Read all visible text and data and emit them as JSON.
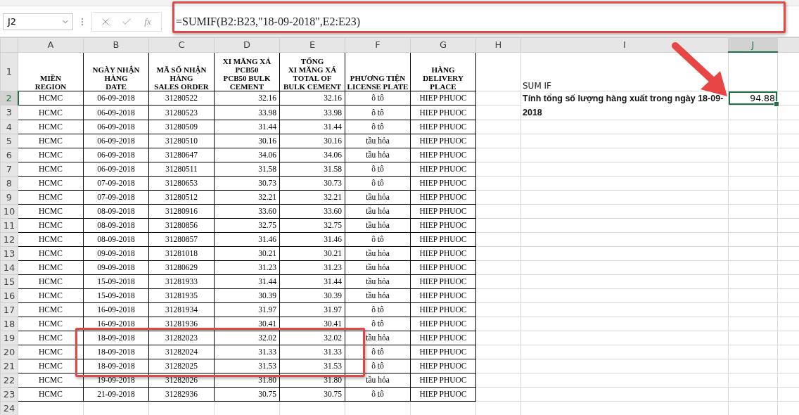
{
  "formula_bar": {
    "name_box": "J2",
    "function_label": "fx",
    "formula": "=SUMIF(B2:B23,\"18-09-2018\",E2:E23)"
  },
  "columns": [
    {
      "label": "A",
      "selected": false
    },
    {
      "label": "B",
      "selected": false
    },
    {
      "label": "C",
      "selected": false
    },
    {
      "label": "D",
      "selected": false
    },
    {
      "label": "E",
      "selected": false
    },
    {
      "label": "F",
      "selected": false
    },
    {
      "label": "G",
      "selected": false
    },
    {
      "label": "H",
      "selected": false
    },
    {
      "label": "I",
      "selected": false
    },
    {
      "label": "J",
      "selected": true
    }
  ],
  "header_row": {
    "number": "1",
    "selected": false,
    "cells": [
      "MIỀN\nREGION",
      "NGÀY NHẬN\nHÀNG\nDATE",
      "MÃ SỐ NHẬN\nHÀNG\nSALES ORDER",
      "XI MĂNG XÁ\nPCB50\nPCB50 BULK\nCEMENT",
      "TỔNG\nXI MĂNG XÁ\nTOTAL OF\nBULK CEMENT",
      "PHƯƠNG TIỆN\nLICENSE PLATE",
      "HÀNG\nDELIVERY\nPLACE"
    ]
  },
  "summary": {
    "label": "SUM IF",
    "description": "Tính tổng số lượng hàng xuất trong ngày 18-09-2018",
    "result": "94.88",
    "result_selected": true
  },
  "rows": [
    {
      "number": "2",
      "selected": true,
      "cells": [
        "HCMC",
        "06-09-2018",
        "31280522",
        "32.16",
        "32.16",
        "ô tô",
        "HIEP PHUOC"
      ]
    },
    {
      "number": "3",
      "selected": false,
      "cells": [
        "HCMC",
        "06-09-2018",
        "31280523",
        "33.98",
        "33.98",
        "ô tô",
        "HIEP PHUOC"
      ]
    },
    {
      "number": "4",
      "selected": false,
      "cells": [
        "HCMC",
        "06-09-2018",
        "31280509",
        "31.44",
        "31.44",
        "ô tô",
        "HIEP PHUOC"
      ]
    },
    {
      "number": "5",
      "selected": false,
      "cells": [
        "HCMC",
        "06-09-2018",
        "31280510",
        "30.16",
        "30.16",
        "tầu hỏa",
        "HIEP PHUOC"
      ]
    },
    {
      "number": "6",
      "selected": false,
      "cells": [
        "HCMC",
        "06-09-2018",
        "31280647",
        "34.06",
        "34.06",
        "tầu hỏa",
        "HIEP PHUOC"
      ]
    },
    {
      "number": "7",
      "selected": false,
      "cells": [
        "HCMC",
        "06-09-2018",
        "31280511",
        "31.58",
        "31.58",
        "ô tô",
        "HIEP PHUOC"
      ]
    },
    {
      "number": "8",
      "selected": false,
      "cells": [
        "HCMC",
        "07-09-2018",
        "31280653",
        "30.73",
        "30.73",
        "ô tô",
        "HIEP PHUOC"
      ]
    },
    {
      "number": "9",
      "selected": false,
      "cells": [
        "HCMC",
        "07-09-2018",
        "31280512",
        "32.21",
        "32.21",
        "tầu hỏa",
        "HIEP PHUOC"
      ]
    },
    {
      "number": "10",
      "selected": false,
      "cells": [
        "HCMC",
        "08-09-2018",
        "31280916",
        "33.60",
        "33.60",
        "tầu hỏa",
        "HIEP PHUOC"
      ]
    },
    {
      "number": "11",
      "selected": false,
      "cells": [
        "HCMC",
        "08-09-2018",
        "31280856",
        "32.75",
        "32.75",
        "tầu hỏa",
        "HIEP PHUOC"
      ]
    },
    {
      "number": "12",
      "selected": false,
      "cells": [
        "HCMC",
        "08-09-2018",
        "31280857",
        "31.46",
        "31.46",
        "ô tô",
        "HIEP PHUOC"
      ]
    },
    {
      "number": "13",
      "selected": false,
      "cells": [
        "HCMC",
        "09-09-2018",
        "31281018",
        "30.21",
        "30.21",
        "tầu hỏa",
        "HIEP PHUOC"
      ]
    },
    {
      "number": "14",
      "selected": false,
      "cells": [
        "HCMC",
        "09-09-2018",
        "31280629",
        "31.23",
        "31.23",
        "tầu hỏa",
        "HIEP PHUOC"
      ]
    },
    {
      "number": "15",
      "selected": false,
      "cells": [
        "HCMC",
        "15-09-2018",
        "31281933",
        "31.44",
        "31.44",
        "tầu hỏa",
        "HIEP PHUOC"
      ]
    },
    {
      "number": "16",
      "selected": false,
      "cells": [
        "HCMC",
        "15-09-2018",
        "31281935",
        "30.39",
        "30.39",
        "tầu hỏa",
        "HIEP PHUOC"
      ]
    },
    {
      "number": "17",
      "selected": false,
      "cells": [
        "HCMC",
        "16-09-2018",
        "31281934",
        "31.97",
        "31.97",
        "ô tô",
        "HIEP PHUOC"
      ]
    },
    {
      "number": "18",
      "selected": false,
      "cells": [
        "HCMC",
        "16-09-2018",
        "31281936",
        "30.41",
        "30.41",
        "ô tô",
        "HIEP PHUOC"
      ]
    },
    {
      "number": "19",
      "selected": false,
      "cells": [
        "HCMC",
        "18-09-2018",
        "31282023",
        "32.02",
        "32.02",
        "tầu hỏa",
        "HIEP PHUOC"
      ]
    },
    {
      "number": "20",
      "selected": false,
      "cells": [
        "HCMC",
        "18-09-2018",
        "31282024",
        "31.33",
        "31.33",
        "ô tô",
        "HIEP PHUOC"
      ]
    },
    {
      "number": "21",
      "selected": false,
      "cells": [
        "HCMC",
        "18-09-2018",
        "31282025",
        "31.53",
        "31.53",
        "ô tô",
        "HIEP PHUOC"
      ]
    },
    {
      "number": "22",
      "selected": false,
      "cells": [
        "HCMC",
        "19-09-2018",
        "31282026",
        "31.80",
        "31.80",
        "tầu hỏa",
        "HIEP PHUOC"
      ]
    },
    {
      "number": "23",
      "selected": false,
      "cells": [
        "HCMC",
        "21-09-2018",
        "31282936",
        "30.75",
        "30.75",
        "ô tô",
        "HIEP PHUOC"
      ]
    }
  ],
  "empty_rows": [
    {
      "number": "24",
      "selected": false
    }
  ]
}
